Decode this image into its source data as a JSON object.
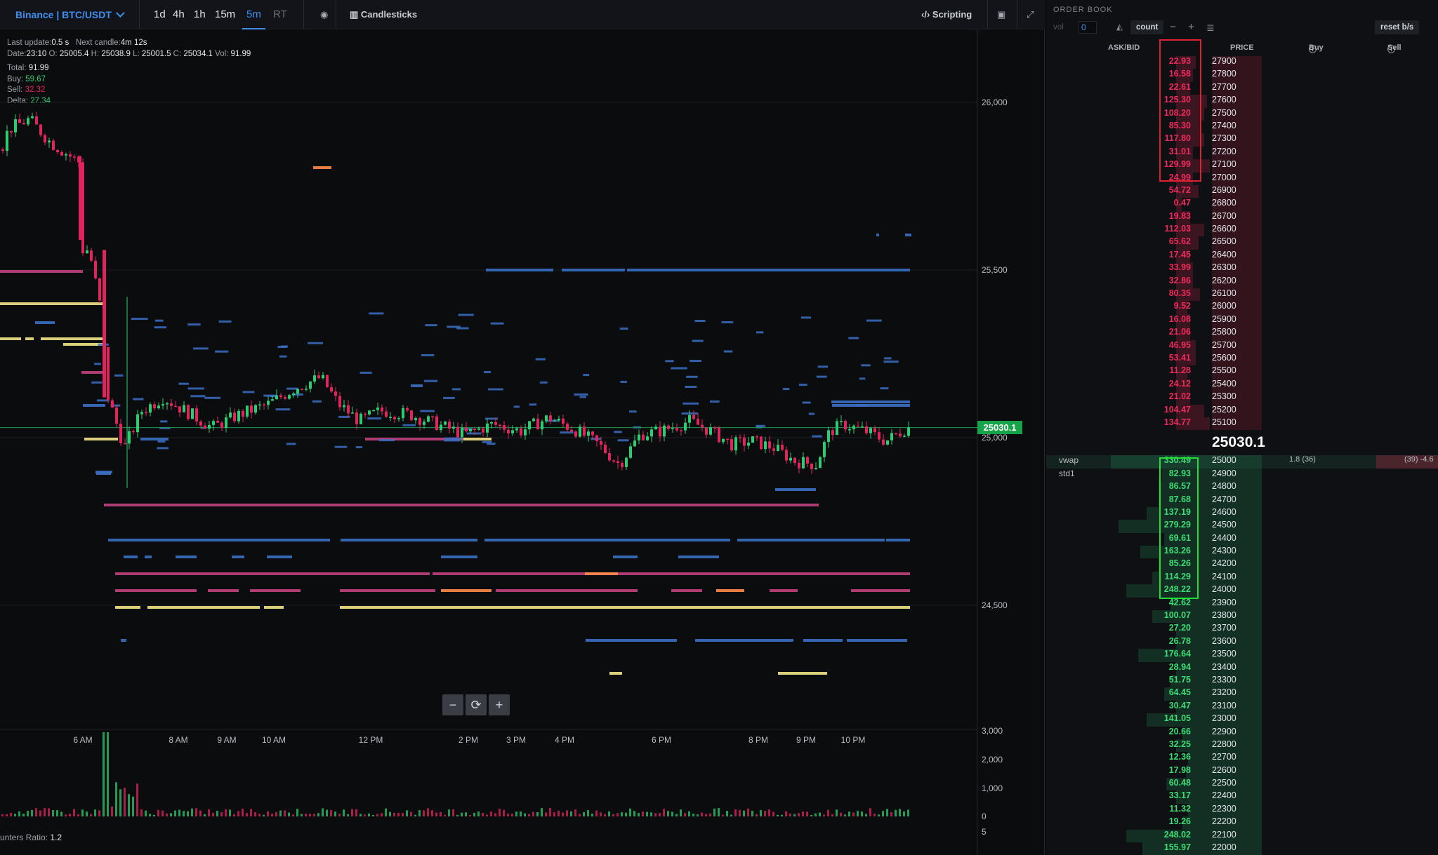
{
  "toolbar": {
    "symbol": "Binance | BTC/USDT",
    "timeframes": [
      "1d",
      "4h",
      "1h",
      "15m",
      "5m",
      "RT"
    ],
    "active_timeframe": "5m",
    "eye_icon": "eye-icon",
    "chart_type": "Candlesticks",
    "scripting": "Scripting",
    "camera_icon": "camera-icon",
    "expand_icon": "expand-icon"
  },
  "info": {
    "last_update_label": "Last update:",
    "last_update": "0.5 s",
    "next_candle_label": "Next candle:",
    "next_candle": "4m 12s",
    "date_label": "Date:",
    "date": "23:10",
    "o_label": "O:",
    "o": "25005.4",
    "h_label": "H:",
    "h": "25038.9",
    "l_label": "L:",
    "l": "25001.5",
    "c_label": "C:",
    "c": "25034.1",
    "vol_label": "Vol:",
    "vol": "91.99",
    "total_label": "Total:",
    "total": "91.99",
    "buy_label": "Buy:",
    "buy": "59.67",
    "sell_label": "Sell:",
    "sell": "32.32",
    "delta_label": "Delta:",
    "delta": "27.34"
  },
  "chart_data": {
    "type": "candlestick",
    "price_axis": [
      "26,000",
      "25,500",
      "25,000",
      "24,500"
    ],
    "price_range": [
      24150,
      26250
    ],
    "volume_axis": [
      "3,000",
      "2,000",
      "1,000",
      "0",
      "5"
    ],
    "time_labels": [
      "6 AM",
      "8 AM",
      "9 AM",
      "10 AM",
      "12 PM",
      "2 PM",
      "3 PM",
      "4 PM",
      "6 PM",
      "8 PM",
      "9 PM",
      "10 PM"
    ],
    "current_price": "25030.1",
    "colors": {
      "up": "#2ecc71",
      "down": "#e0245e",
      "heat_blue": "#3b6fc4",
      "heat_yellow": "#f2e48a",
      "heat_orange": "#ff8c4a",
      "heat_pink": "#c0407e"
    }
  },
  "zoom": {
    "minus": "−",
    "reset": "⟳",
    "plus": "+"
  },
  "ratio": {
    "label": "unters Ratio:",
    "value": "1.2"
  },
  "orderbook": {
    "title": "ORDER BOOK",
    "vol_label": "vol",
    "vol_value": "0",
    "count_label": "count",
    "reset_label": "reset b/s",
    "headers": {
      "askbid": "ASK/BID",
      "price": "PRICE",
      "buy": "Buy",
      "sell": "Sell"
    },
    "asks": [
      {
        "q": "22.93",
        "p": "27900",
        "w": 0.35
      },
      {
        "q": "16.58",
        "p": "27800",
        "w": 0.3
      },
      {
        "q": "22.61",
        "p": "27700",
        "w": 0.25
      },
      {
        "q": "125.30",
        "p": "27600",
        "w": 0.55
      },
      {
        "q": "108.20",
        "p": "27500",
        "w": 0.5
      },
      {
        "q": "85.30",
        "p": "27400",
        "w": 0.45
      },
      {
        "q": "117.80",
        "p": "27300",
        "w": 0.5
      },
      {
        "q": "31.01",
        "p": "27200",
        "w": 0.3
      },
      {
        "q": "129.99",
        "p": "27100",
        "w": 0.6
      },
      {
        "q": "24.99",
        "p": "27000",
        "w": 0.3
      },
      {
        "q": "54.72",
        "p": "26900",
        "w": 0.4
      },
      {
        "q": "0.47",
        "p": "26800",
        "w": 0.1
      },
      {
        "q": "19.83",
        "p": "26700",
        "w": 0.25
      },
      {
        "q": "112.03",
        "p": "26600",
        "w": 0.5
      },
      {
        "q": "65.62",
        "p": "26500",
        "w": 0.4
      },
      {
        "q": "17.45",
        "p": "26400",
        "w": 0.25
      },
      {
        "q": "33.99",
        "p": "26300",
        "w": 0.3
      },
      {
        "q": "32.86",
        "p": "26200",
        "w": 0.3
      },
      {
        "q": "80.35",
        "p": "26100",
        "w": 0.42
      },
      {
        "q": "9.52",
        "p": "26000",
        "w": 0.2
      },
      {
        "q": "16.08",
        "p": "25900",
        "w": 0.25
      },
      {
        "q": "21.06",
        "p": "25800",
        "w": 0.25
      },
      {
        "q": "46.95",
        "p": "25700",
        "w": 0.35
      },
      {
        "q": "53.41",
        "p": "25600",
        "w": 0.35
      },
      {
        "q": "11.28",
        "p": "25500",
        "w": 0.2
      },
      {
        "q": "24.12",
        "p": "25400",
        "w": 0.25
      },
      {
        "q": "21.02",
        "p": "25300",
        "w": 0.25
      },
      {
        "q": "104.47",
        "p": "25200",
        "w": 0.5
      },
      {
        "q": "134.77",
        "p": "25100",
        "w": 0.6
      }
    ],
    "mid_price": "25030.1",
    "vwap_label": "vwap",
    "std_label": "std1",
    "buy_cell": "1.8",
    "buy_cell_count": "(36)",
    "sell_cell_count": "(39)",
    "sell_cell": "-4.6",
    "bids": [
      {
        "q": "330.49",
        "p": "25000",
        "w": 0.85
      },
      {
        "q": "82.93",
        "p": "24900",
        "w": 0.42
      },
      {
        "q": "86.57",
        "p": "24800",
        "w": 0.45
      },
      {
        "q": "87.68",
        "p": "24700",
        "w": 0.45
      },
      {
        "q": "137.19",
        "p": "24600",
        "w": 0.55
      },
      {
        "q": "279.29",
        "p": "24500",
        "w": 0.78
      },
      {
        "q": "69.61",
        "p": "24400",
        "w": 0.4
      },
      {
        "q": "163.26",
        "p": "24300",
        "w": 0.6
      },
      {
        "q": "85.26",
        "p": "24200",
        "w": 0.45
      },
      {
        "q": "114.29",
        "p": "24100",
        "w": 0.5
      },
      {
        "q": "248.22",
        "p": "24000",
        "w": 0.72
      },
      {
        "q": "42.62",
        "p": "23900",
        "w": 0.35
      },
      {
        "q": "100.07",
        "p": "23800",
        "w": 0.5
      },
      {
        "q": "27.20",
        "p": "23700",
        "w": 0.3
      },
      {
        "q": "26.78",
        "p": "23600",
        "w": 0.3
      },
      {
        "q": "176.64",
        "p": "23500",
        "w": 0.62
      },
      {
        "q": "28.94",
        "p": "23400",
        "w": 0.3
      },
      {
        "q": "51.75",
        "p": "23300",
        "w": 0.35
      },
      {
        "q": "64.45",
        "p": "23200",
        "w": 0.4
      },
      {
        "q": "30.47",
        "p": "23100",
        "w": 0.3
      },
      {
        "q": "141.05",
        "p": "23000",
        "w": 0.55
      },
      {
        "q": "20.66",
        "p": "22900",
        "w": 0.25
      },
      {
        "q": "32.25",
        "p": "22800",
        "w": 0.3
      },
      {
        "q": "12.36",
        "p": "22700",
        "w": 0.2
      },
      {
        "q": "17.98",
        "p": "22600",
        "w": 0.22
      },
      {
        "q": "60.48",
        "p": "22500",
        "w": 0.38
      },
      {
        "q": "33.17",
        "p": "22400",
        "w": 0.3
      },
      {
        "q": "11.32",
        "p": "22300",
        "w": 0.2
      },
      {
        "q": "19.26",
        "p": "22200",
        "w": 0.25
      },
      {
        "q": "248.02",
        "p": "22100",
        "w": 0.72
      },
      {
        "q": "155.97",
        "p": "22000",
        "w": 0.58
      }
    ]
  }
}
